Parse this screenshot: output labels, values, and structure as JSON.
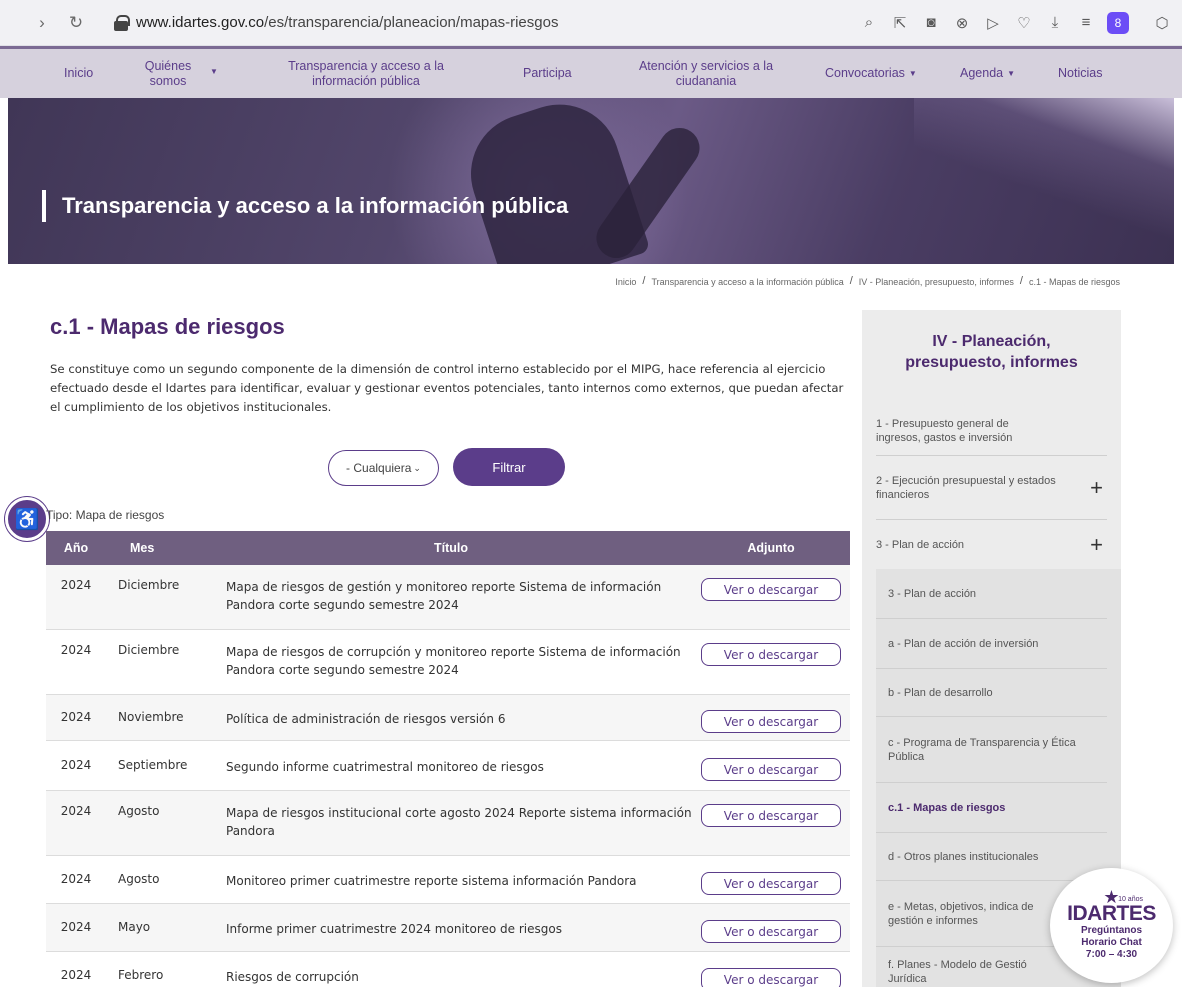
{
  "browser": {
    "url_host": "www.idartes.gov.co",
    "url_path": "/es/transparencia/planeacion/mapas-riesgos",
    "profile_initial": "8"
  },
  "nav": {
    "items": [
      {
        "label": "Inicio"
      },
      {
        "label": "Quiénes somos"
      },
      {
        "label": "Transparencia y acceso a la información pública"
      },
      {
        "label": "Participa"
      },
      {
        "label": "Atención y servicios a la ciudanania"
      },
      {
        "label": "Convocatorias"
      },
      {
        "label": "Agenda"
      },
      {
        "label": "Noticias"
      }
    ]
  },
  "hero": {
    "title": "Transparencia y acceso a la información pública"
  },
  "breadcrumb": [
    "Inicio",
    "Transparencia y acceso a la información pública",
    "IV - Planeación, presupuesto, informes",
    "c.1 - Mapas de riesgos"
  ],
  "main": {
    "title": "c.1 - Mapas de riesgos",
    "intro": "Se constituye como un segundo componente de la dimensión de control interno establecido por el MIPG, hace referencia al ejercicio efectuado desde el Idartes para identificar, evaluar y gestionar eventos potenciales, tanto internos como externos, que puedan afectar el cumplimiento de los objetivos institucionales.",
    "filter_value": "- Cualquiera",
    "filter_button": "Filtrar",
    "type_label": "Tipo: Mapa de riesgos"
  },
  "table": {
    "headers": {
      "year": "Año",
      "month": "Mes",
      "title": "Título",
      "attachment": "Adjunto"
    },
    "button_label": "Ver o descargar",
    "rows": [
      {
        "year": "2024",
        "month": "Diciembre",
        "title": "Mapa de riesgos de gestión y monitoreo reporte Sistema de información Pandora corte segundo semestre 2024"
      },
      {
        "year": "2024",
        "month": "Diciembre",
        "title": "Mapa de riesgos de corrupción y monitoreo reporte Sistema de información Pandora corte segundo semestre 2024"
      },
      {
        "year": "2024",
        "month": "Noviembre",
        "title": "Política de administración de riesgos versión 6"
      },
      {
        "year": "2024",
        "month": "Septiembre",
        "title": "Segundo informe cuatrimestral monitoreo de riesgos"
      },
      {
        "year": "2024",
        "month": "Agosto",
        "title": "Mapa de riesgos institucional corte agosto 2024 Reporte sistema información Pandora"
      },
      {
        "year": "2024",
        "month": "Agosto",
        "title": "Monitoreo primer cuatrimestre reporte sistema información Pandora"
      },
      {
        "year": "2024",
        "month": "Mayo",
        "title": "Informe primer cuatrimestre 2024 monitoreo de riesgos"
      },
      {
        "year": "2024",
        "month": "Febrero",
        "title": "Riesgos de corrupción"
      }
    ]
  },
  "sidebar": {
    "title": "IV - Planeación, presupuesto, informes",
    "items": [
      {
        "label": "1 - Presupuesto general de ingresos, gastos e inversión"
      },
      {
        "label": "2 - Ejecución presupuestal y estados financieros"
      },
      {
        "label": "3 - Plan de acción"
      }
    ],
    "sub_items": [
      {
        "label": "3 - Plan de acción"
      },
      {
        "label": "a - Plan de acción de inversión"
      },
      {
        "label": "b - Plan de desarrollo"
      },
      {
        "label": "c - Programa de Transparencia y Ética Pública"
      },
      {
        "label": "c.1 - Mapas de riesgos"
      },
      {
        "label": "d - Otros planes institucionales"
      },
      {
        "label": "e - Metas, objetivos, indica de gestión e informes"
      },
      {
        "label": "f. Planes - Modelo de Gestió Jurídica"
      }
    ]
  },
  "chat": {
    "badge": "10 años",
    "logo": "IDARTES",
    "line1": "Pregúntanos",
    "line2": "Horario Chat",
    "line3": "7:00 – 4:30"
  },
  "colors": {
    "brand_purple": "#5b3d8a",
    "table_header": "#6f5f80",
    "title_purple": "#4c2a6e"
  }
}
